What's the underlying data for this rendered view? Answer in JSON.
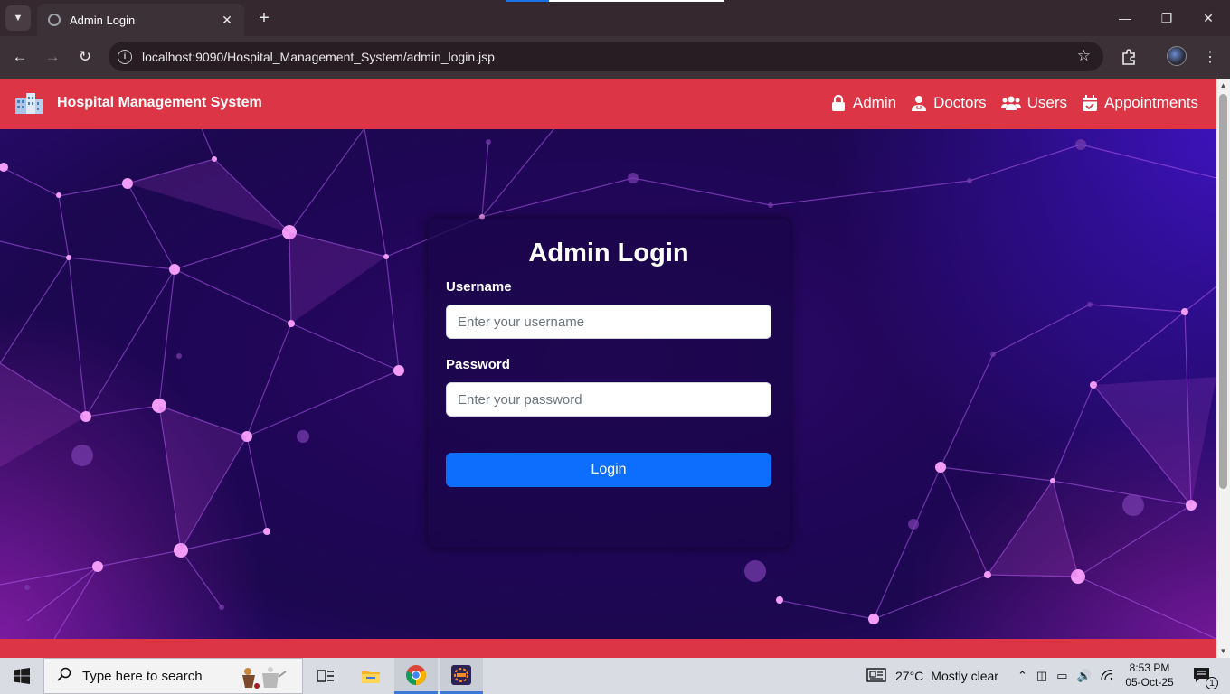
{
  "browser": {
    "tab_title": "Admin Login",
    "url": "localhost:9090/Hospital_Management_System/admin_login.jsp"
  },
  "navbar": {
    "brand": "Hospital Management System",
    "links": [
      {
        "label": "Admin",
        "icon": "lock-icon"
      },
      {
        "label": "Doctors",
        "icon": "user-doctor-icon"
      },
      {
        "label": "Users",
        "icon": "users-icon"
      },
      {
        "label": "Appointments",
        "icon": "calendar-check-icon"
      }
    ]
  },
  "login": {
    "title": "Admin Login",
    "username_label": "Username",
    "username_placeholder": "Enter your username",
    "username_value": "",
    "password_label": "Password",
    "password_placeholder": "Enter your password",
    "password_value": "",
    "button": "Login"
  },
  "colors": {
    "navbar": "#dc3545",
    "button": "#0d6efd",
    "background": "#210658"
  },
  "taskbar": {
    "search_placeholder": "Type here to search",
    "weather_temp": "27°C",
    "weather_text": "Mostly clear",
    "time": "8:53 PM",
    "date": "05-Oct-25",
    "notification_count": "1"
  }
}
